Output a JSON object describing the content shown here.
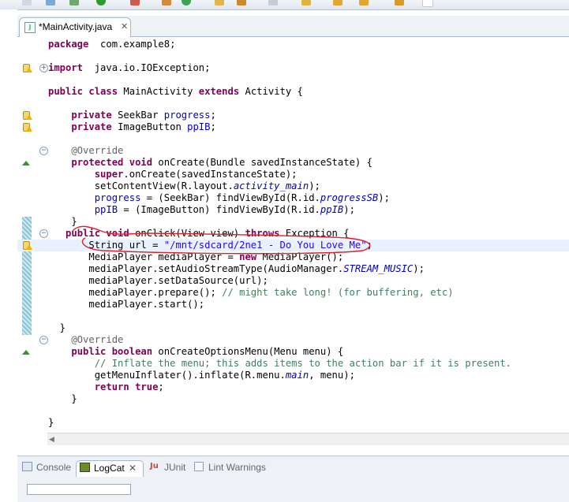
{
  "editor_tab": {
    "title": "*MainActivity.java",
    "close_glyph": "✕",
    "icon": "java-file-icon"
  },
  "code_lines": [
    {
      "tokens": [
        [
          "kw",
          "package"
        ],
        [
          "",
          "  com.example8;"
        ]
      ]
    },
    {
      "tokens": []
    },
    {
      "tokens": [
        [
          "kw",
          "import"
        ],
        [
          "",
          "  java.io.IOException;"
        ]
      ]
    },
    {
      "tokens": []
    },
    {
      "tokens": [
        [
          "kw",
          "public class"
        ],
        [
          "",
          " MainActivity "
        ],
        [
          "kw",
          "extends"
        ],
        [
          "",
          " Activity {"
        ]
      ]
    },
    {
      "tokens": []
    },
    {
      "tokens": [
        [
          "",
          "    "
        ],
        [
          "kw",
          "private"
        ],
        [
          "",
          " SeekBar "
        ],
        [
          "field",
          "progress"
        ],
        [
          "",
          ";"
        ]
      ]
    },
    {
      "tokens": [
        [
          "",
          "    "
        ],
        [
          "kw",
          "private"
        ],
        [
          "",
          " ImageButton "
        ],
        [
          "field",
          "ppIB"
        ],
        [
          "",
          ";"
        ]
      ]
    },
    {
      "tokens": []
    },
    {
      "tokens": [
        [
          "ann",
          "    @Override"
        ]
      ]
    },
    {
      "tokens": [
        [
          "",
          "    "
        ],
        [
          "kw",
          "protected void"
        ],
        [
          "",
          " onCreate(Bundle savedInstanceState) {"
        ]
      ]
    },
    {
      "tokens": [
        [
          "",
          "        "
        ],
        [
          "kw",
          "super"
        ],
        [
          "",
          ".onCreate(savedInstanceState);"
        ]
      ]
    },
    {
      "tokens": [
        [
          "",
          "        setContentView(R.layout."
        ],
        [
          "sfield",
          "activity_main"
        ],
        [
          "",
          ");"
        ]
      ]
    },
    {
      "tokens": [
        [
          "",
          "        "
        ],
        [
          "field",
          "progress"
        ],
        [
          "",
          " = (SeekBar) findViewById(R.id."
        ],
        [
          "sfield",
          "progressSB"
        ],
        [
          "",
          ");"
        ]
      ]
    },
    {
      "tokens": [
        [
          "",
          "        "
        ],
        [
          "field",
          "ppIB"
        ],
        [
          "",
          " = (ImageButton) findViewById(R.id."
        ],
        [
          "sfield",
          "ppIB"
        ],
        [
          "",
          ");"
        ]
      ]
    },
    {
      "tokens": [
        [
          "",
          "    }"
        ]
      ]
    },
    {
      "tokens": [
        [
          "",
          "   "
        ],
        [
          "kw",
          "public void"
        ],
        [
          "",
          " onClick(View view) "
        ],
        [
          "kw",
          "throws"
        ],
        [
          "",
          " Exception {"
        ]
      ]
    },
    {
      "tokens": [
        [
          "",
          "       String url = "
        ],
        [
          "str",
          "\"/mnt/sdcard/2ne1 - Do You Love Me\""
        ],
        [
          "",
          ";"
        ]
      ]
    },
    {
      "tokens": [
        [
          "",
          "       MediaPlayer mediaPlayer = "
        ],
        [
          "kw",
          "new"
        ],
        [
          "",
          " MediaPlayer();"
        ]
      ]
    },
    {
      "tokens": [
        [
          "",
          "       mediaPlayer.setAudioStreamType(AudioManager."
        ],
        [
          "sfield",
          "STREAM_MUSIC"
        ],
        [
          "",
          ");"
        ]
      ]
    },
    {
      "tokens": [
        [
          "",
          "       mediaPlayer.setDataSource(url);"
        ]
      ]
    },
    {
      "tokens": [
        [
          "",
          "       mediaPlayer.prepare(); "
        ],
        [
          "cmt",
          "// might take long! (for buffering, etc)"
        ]
      ]
    },
    {
      "tokens": [
        [
          "",
          "       mediaPlayer.start();"
        ]
      ]
    },
    {
      "tokens": []
    },
    {
      "tokens": [
        [
          "",
          "  }"
        ]
      ]
    },
    {
      "tokens": [
        [
          "ann",
          "    @Override"
        ]
      ]
    },
    {
      "tokens": [
        [
          "",
          "    "
        ],
        [
          "kw",
          "public boolean"
        ],
        [
          "",
          " onCreateOptionsMenu(Menu menu) {"
        ]
      ]
    },
    {
      "tokens": [
        [
          "",
          "        "
        ],
        [
          "cmt",
          "// Inflate the menu; this adds items to the action bar if it is present."
        ]
      ]
    },
    {
      "tokens": [
        [
          "",
          "        getMenuInflater().inflate(R.menu."
        ],
        [
          "sfield",
          "main"
        ],
        [
          "",
          ", menu);"
        ]
      ]
    },
    {
      "tokens": [
        [
          "",
          "        "
        ],
        [
          "kw",
          "return true"
        ],
        [
          "",
          ";"
        ]
      ]
    },
    {
      "tokens": [
        [
          "",
          "    }"
        ]
      ]
    },
    {
      "tokens": []
    },
    {
      "tokens": [
        [
          "",
          "}"
        ]
      ]
    }
  ],
  "gutter": {
    "warning_lines": [
      2,
      6,
      7,
      17
    ],
    "override_lines": [
      10,
      26
    ],
    "fold_lines": [
      9,
      16,
      25
    ],
    "expand_lines": [
      2
    ],
    "highlighted_line": 17
  },
  "bottom_tabs": [
    {
      "label": "Console",
      "icon": "console-icon",
      "active": false
    },
    {
      "label": "LogCat",
      "icon": "logcat-icon",
      "active": true
    },
    {
      "label": "JUnit",
      "icon": "junit-icon",
      "active": false
    },
    {
      "label": "Lint Warnings",
      "icon": "lint-warnings-icon",
      "active": false
    }
  ],
  "colors": {
    "keyword": "#7f0055",
    "field": "#0000c0",
    "string": "#2a00ff",
    "comment": "#3f7f5f",
    "annotation": "#646464",
    "highlight": "#e8f2fe",
    "freehand_marker": "#e0202a"
  }
}
